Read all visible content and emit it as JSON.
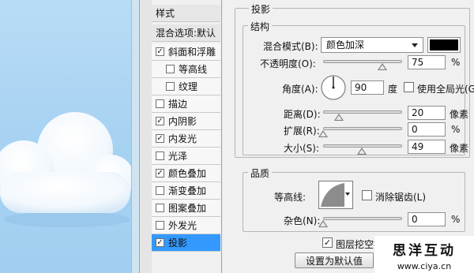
{
  "styles_list": {
    "header": "样式",
    "blend_options": "混合选项:默认",
    "items": [
      {
        "label": "斜面和浮雕",
        "checked": true
      },
      {
        "label": "等高线",
        "checked": false,
        "indent": true
      },
      {
        "label": "纹理",
        "checked": false,
        "indent": true
      },
      {
        "label": "描边",
        "checked": false
      },
      {
        "label": "内阴影",
        "checked": true
      },
      {
        "label": "内发光",
        "checked": true
      },
      {
        "label": "光泽",
        "checked": false
      },
      {
        "label": "颜色叠加",
        "checked": true
      },
      {
        "label": "渐变叠加",
        "checked": false
      },
      {
        "label": "图案叠加",
        "checked": false
      },
      {
        "label": "外发光",
        "checked": false
      },
      {
        "label": "投影",
        "checked": true,
        "selected": true
      }
    ]
  },
  "panel": {
    "title": "投影",
    "structure": {
      "title": "结构",
      "blend_mode_label": "混合模式(B):",
      "blend_mode_value": "颜色加深",
      "shadow_color": "#000000",
      "opacity_label": "不透明度(O):",
      "opacity_value": "75",
      "opacity_unit": "%",
      "angle_label": "角度(A):",
      "angle_value": "90",
      "angle_unit": "度",
      "global_light_label": "使用全局光(G)",
      "global_light_checked": false,
      "distance_label": "距离(D):",
      "distance_value": "20",
      "distance_unit": "像素",
      "spread_label": "扩展(R):",
      "spread_value": "0",
      "spread_unit": "%",
      "size_label": "大小(S):",
      "size_value": "49",
      "size_unit": "像素"
    },
    "quality": {
      "title": "品质",
      "contour_label": "等高线:",
      "anti_alias_label": "消除锯齿(L)",
      "anti_alias_checked": false,
      "noise_label": "杂色(N):",
      "noise_value": "0",
      "noise_unit": "%"
    },
    "knockout_label": "图层挖空投影",
    "knockout_checked": true,
    "make_default_label": "设置为默认值"
  },
  "watermark": {
    "title": "思洋互动",
    "url": "www.ciya.cn"
  }
}
